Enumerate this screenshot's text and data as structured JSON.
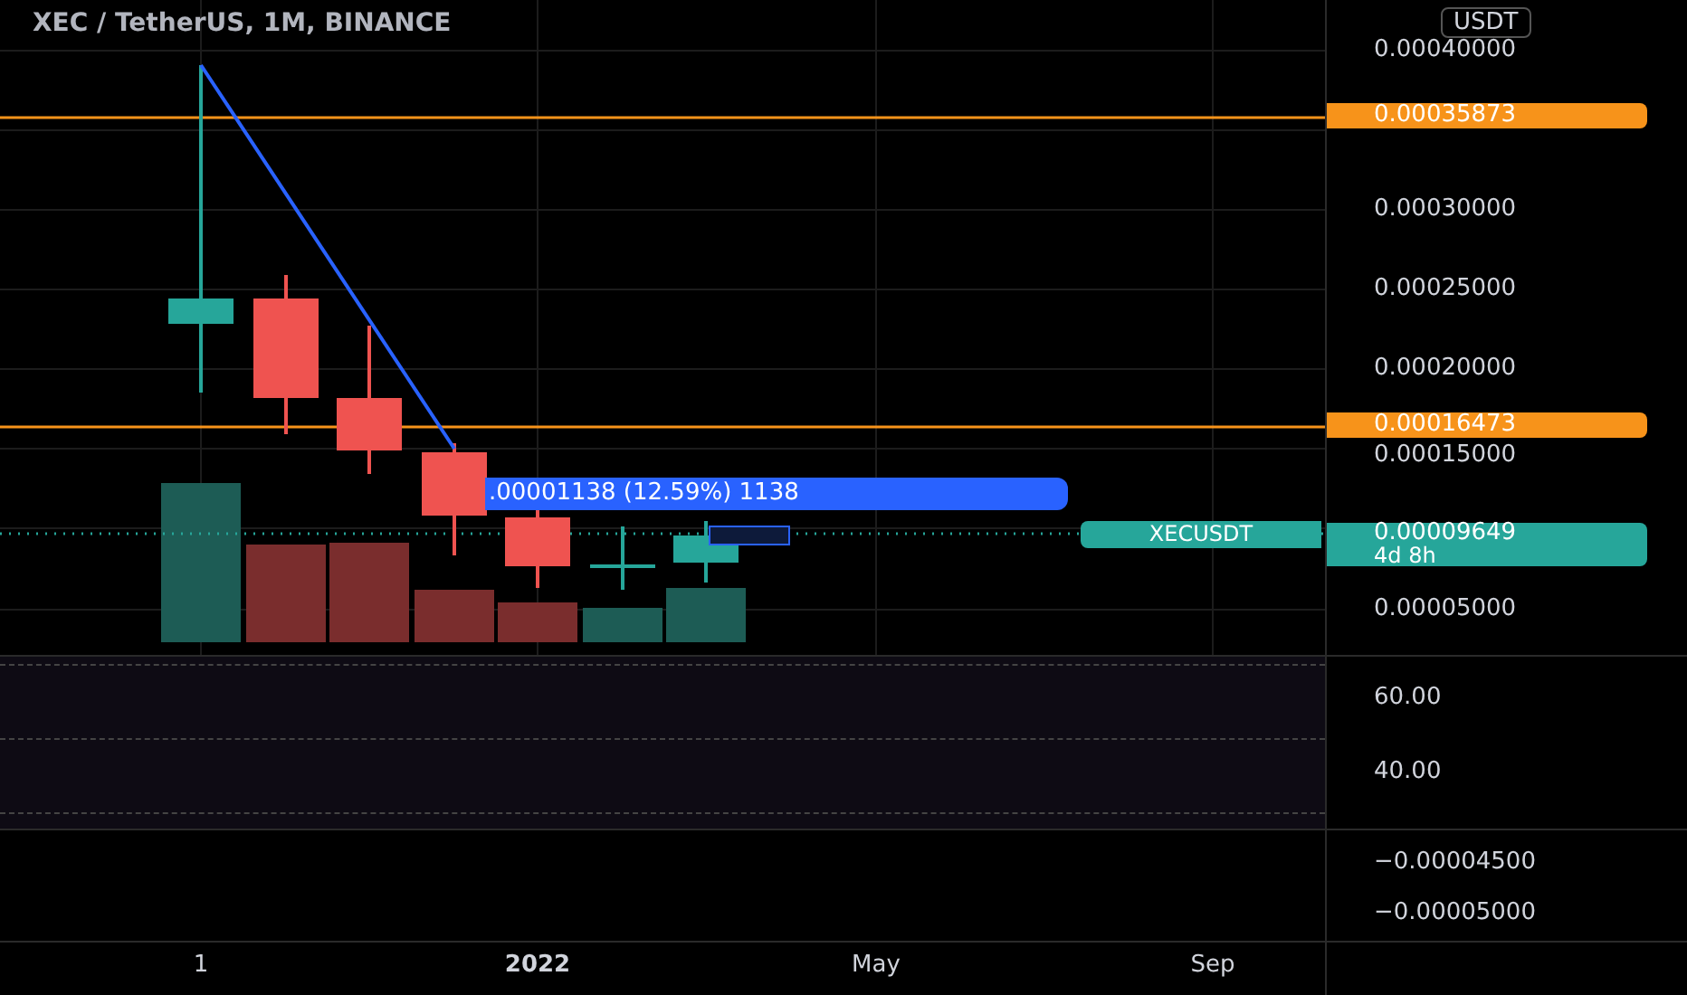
{
  "header": {
    "title": "XEC / TetherUS, 1M, BINANCE",
    "currency": "USDT"
  },
  "price_axis": {
    "ticks": [
      "0.00040000",
      "0.00030000",
      "0.00025000",
      "0.00020000",
      "0.00015000",
      "0.00005000"
    ]
  },
  "price_lines": [
    {
      "label": "0.00035873"
    },
    {
      "label": "0.00016473"
    }
  ],
  "current_price": {
    "symbol": "XECUSDT",
    "price": "0.00009649",
    "countdown": "4d 8h"
  },
  "measure_label": ".00001138 (12.59%) 1138",
  "oscillator_axis": {
    "ticks": [
      "60.00",
      "40.00"
    ]
  },
  "lower_axis": {
    "ticks": [
      "−0.00004500",
      "−0.00005000"
    ]
  },
  "time_axis": [
    {
      "label": "1",
      "bold": false
    },
    {
      "label": "2022",
      "bold": true
    },
    {
      "label": "May",
      "bold": false
    },
    {
      "label": "Sep",
      "bold": false
    }
  ]
}
